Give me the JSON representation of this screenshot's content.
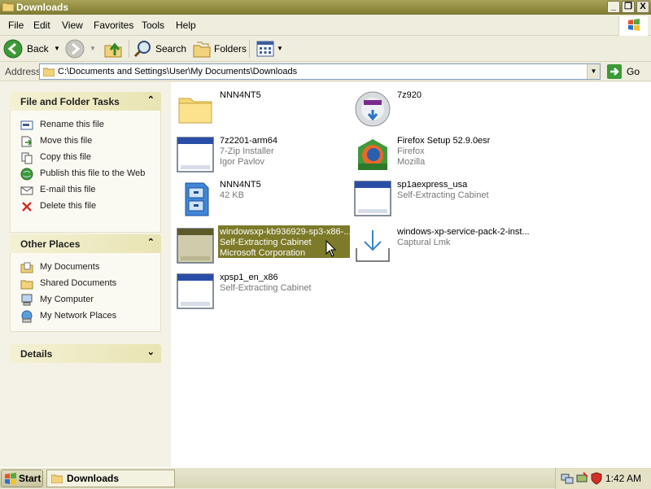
{
  "window": {
    "title": "Downloads",
    "controls": {
      "minimize": "_",
      "restore": "❐",
      "close": "X"
    }
  },
  "menu": [
    "File",
    "Edit",
    "View",
    "Favorites",
    "Tools",
    "Help"
  ],
  "toolbar": {
    "back": "Back",
    "search": "Search",
    "folders": "Folders"
  },
  "address": {
    "label": "Address",
    "value": "C:\\Documents and Settings\\User\\My Documents\\Downloads",
    "go": "Go"
  },
  "tasks": {
    "title": "File and Folder Tasks",
    "items": [
      "Rename this file",
      "Move this file",
      "Copy this file",
      "Publish this file to the Web",
      "E-mail this file",
      "Delete this file"
    ]
  },
  "places": {
    "title": "Other Places",
    "items": [
      "My Documents",
      "Shared Documents",
      "My Computer",
      "My Network Places"
    ]
  },
  "details": {
    "title": "Details"
  },
  "files": [
    {
      "name": "NNN4NT5",
      "line1": "",
      "line2": "",
      "icon": "folder-icon"
    },
    {
      "name": "7z920",
      "line1": "",
      "line2": "",
      "icon": "installer-disc-icon"
    },
    {
      "name": "7z2201-arm64",
      "line1": "7-Zip Installer",
      "line2": "Igor Pavlov",
      "icon": "application-window-icon"
    },
    {
      "name": "Firefox Setup 52.9.0esr",
      "line1": "Firefox",
      "line2": "Mozilla",
      "icon": "firefox-setup-icon"
    },
    {
      "name": "NNN4NT5",
      "line1": "42 KB",
      "line2": "",
      "icon": "file-cabinet-icon"
    },
    {
      "name": "sp1aexpress_usa",
      "line1": "Self-Extracting Cabinet",
      "line2": "",
      "icon": "application-window-icon"
    },
    {
      "name": "windowsxp-kb936929-sp3-x86-...",
      "line1": "Self-Extracting Cabinet",
      "line2": "Microsoft Corporation",
      "icon": "application-window-icon"
    },
    {
      "name": "windows-xp-service-pack-2-inst...",
      "line1": "Captural Lmk",
      "line2": "",
      "icon": "download-tray-icon"
    },
    {
      "name": "xpsp1_en_x86",
      "line1": "Self-Extracting Cabinet",
      "line2": "",
      "icon": "application-window-icon"
    }
  ],
  "taskbar": {
    "start": "Start",
    "window_button": "Downloads",
    "clock": "1:42 AM"
  },
  "colors": {
    "titlebar": "#8f8a3e",
    "selection": "#7d7a29",
    "panel_header": "#e8e4b3"
  }
}
